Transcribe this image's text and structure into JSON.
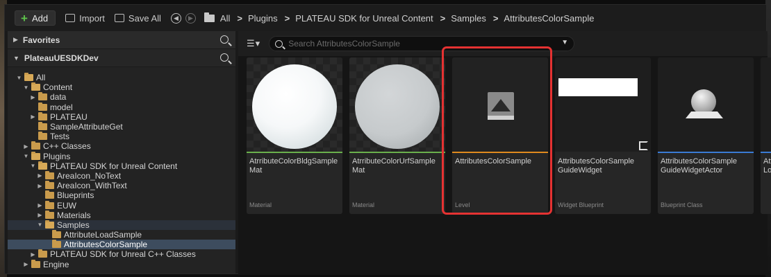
{
  "toolbar": {
    "add_label": "Add",
    "import_label": "Import",
    "save_all_label": "Save All",
    "breadcrumb": [
      "All",
      "Plugins",
      "PLATEAU SDK for Unreal Content",
      "Samples",
      "AttributesColorSample"
    ]
  },
  "left_panel": {
    "favorites_label": "Favorites",
    "project_label": "PlateauUESDKDev",
    "tree": [
      {
        "label": "All",
        "depth": 0,
        "arrow": "▼",
        "open": true
      },
      {
        "label": "Content",
        "depth": 1,
        "arrow": "▼",
        "open": true
      },
      {
        "label": "data",
        "depth": 2,
        "arrow": "▶"
      },
      {
        "label": "model",
        "depth": 2,
        "arrow": ""
      },
      {
        "label": "PLATEAU",
        "depth": 2,
        "arrow": "▶"
      },
      {
        "label": "SampleAttributeGet",
        "depth": 2,
        "arrow": ""
      },
      {
        "label": "Tests",
        "depth": 2,
        "arrow": ""
      },
      {
        "label": "C++ Classes",
        "depth": 1,
        "arrow": "▶"
      },
      {
        "label": "Plugins",
        "depth": 1,
        "arrow": "▼",
        "open": true
      },
      {
        "label": "PLATEAU SDK for Unreal Content",
        "depth": 2,
        "arrow": "▼",
        "open": true
      },
      {
        "label": "AreaIcon_NoText",
        "depth": 3,
        "arrow": "▶"
      },
      {
        "label": "AreaIcon_WithText",
        "depth": 3,
        "arrow": "▶"
      },
      {
        "label": "Blueprints",
        "depth": 3,
        "arrow": ""
      },
      {
        "label": "EUW",
        "depth": 3,
        "arrow": "▶"
      },
      {
        "label": "Materials",
        "depth": 3,
        "arrow": "▶"
      },
      {
        "label": "Samples",
        "depth": 3,
        "arrow": "▼",
        "open": true,
        "hl": true
      },
      {
        "label": "AttributeLoadSample",
        "depth": 4,
        "arrow": ""
      },
      {
        "label": "AttributesColorSample",
        "depth": 4,
        "arrow": "",
        "selected": true
      },
      {
        "label": "PLATEAU SDK for Unreal C++ Classes",
        "depth": 2,
        "arrow": "▶"
      },
      {
        "label": "Engine",
        "depth": 1,
        "arrow": "▶"
      }
    ]
  },
  "search": {
    "placeholder": "Search AttributesColorSample"
  },
  "assets": [
    {
      "name": "AtrributeColorBldgSample Mat",
      "type": "Material",
      "color": "#6ab04c",
      "thumb": "sphere-white"
    },
    {
      "name": "AtrributeColorUrfSample Mat",
      "type": "Material",
      "color": "#6ab04c",
      "thumb": "sphere-grey"
    },
    {
      "name": "AttributesColorSample",
      "type": "Level",
      "color": "#e08a1e",
      "thumb": "level"
    },
    {
      "name": "AttributesColorSample GuideWidget",
      "type": "Widget Blueprint",
      "color": "#262626",
      "thumb": "widget"
    },
    {
      "name": "AttributesColorSample GuideWidgetActor",
      "type": "Blueprint Class",
      "color": "#3a7bd5",
      "thumb": "actor"
    },
    {
      "name": "Attr Lo",
      "type": "",
      "color": "#3a7bd5",
      "thumb": "blank"
    }
  ],
  "colors": {
    "highlight": "#e53232",
    "selected_row": "#3d4c5e",
    "folder": "#c99b4c"
  }
}
